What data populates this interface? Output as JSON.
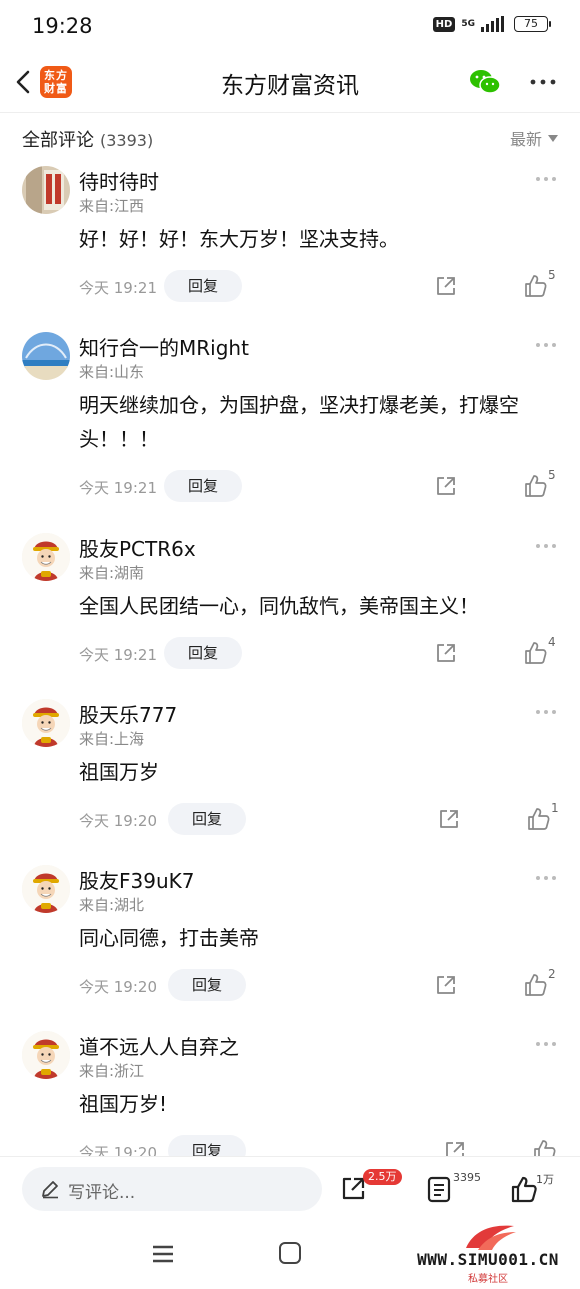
{
  "status_bar": {
    "time": "19:28",
    "hd": "HD",
    "network": "5G",
    "battery": "75"
  },
  "nav": {
    "logo_text_line1": "东方",
    "logo_text_line2": "财富",
    "title": "东方财富资讯",
    "icons": [
      "back-icon",
      "wechat-icon",
      "more-icon"
    ]
  },
  "section": {
    "title": "全部评论",
    "count": "(3393)",
    "sort": "最新"
  },
  "comments": [
    {
      "user": "待时待时",
      "location": "来自:江西",
      "lines": [
        "好！好！好！东大万岁！坚决支持。"
      ],
      "time": "今天 19:21",
      "reply": "回复",
      "likes": "5",
      "avatar": "photo"
    },
    {
      "user": "知行合一的MRight",
      "location": "来自:山东",
      "lines": [
        "明天继续加仓，为国护盘，坚决打爆老美，打爆空",
        "头！！！"
      ],
      "time": "今天 19:21",
      "reply": "回复",
      "likes": "5",
      "avatar": "sky"
    },
    {
      "user": "股友PCTR6x",
      "location": "来自:湖南",
      "lines": [
        "全国人民团结一心，同仇敌忾，美帝国主义！"
      ],
      "time": "今天 19:21",
      "reply": "回复",
      "likes": "4",
      "avatar": "caishen"
    },
    {
      "user": "股天乐777",
      "location": "来自:上海",
      "lines": [
        "祖国万岁"
      ],
      "time": "今天 19:20",
      "reply": "回复",
      "likes": "1",
      "avatar": "caishen"
    },
    {
      "user": "股友F39uK7",
      "location": "来自:湖北",
      "lines": [
        "同心同德，打击美帝"
      ],
      "time": "今天 19:20",
      "reply": "回复",
      "likes": "2",
      "avatar": "caishen"
    },
    {
      "user": "道不远人人自弃之",
      "location": "来自:浙江",
      "lines": [
        "祖国万岁!"
      ],
      "time": "今天 19:20",
      "reply": "回复",
      "likes": "",
      "avatar": "caishen"
    }
  ],
  "bottom_bar": {
    "input_placeholder": "写评论...",
    "share_count": "2.5万",
    "comment_count": "3395",
    "like_count": "1万"
  },
  "watermark": {
    "text": "WWW.SIMU001.CN",
    "sub": "私募社区"
  },
  "colors": {
    "accent": "#f05a16",
    "badge": "#e53935",
    "reply_bg": "#f1f3f7"
  }
}
